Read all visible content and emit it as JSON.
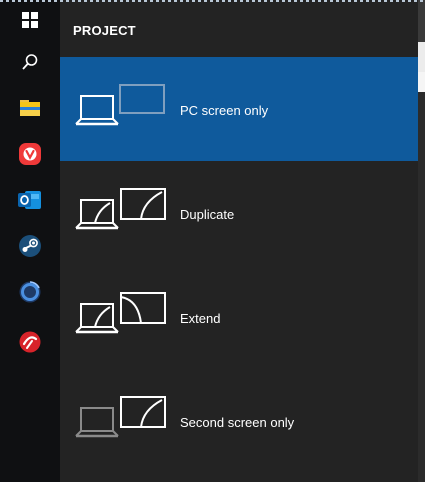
{
  "taskbar": {
    "items": [
      {
        "icon": "windows-start-icon"
      },
      {
        "icon": "search-icon"
      },
      {
        "icon": "file-explorer-icon"
      },
      {
        "icon": "vivaldi-icon"
      },
      {
        "icon": "outlook-icon"
      },
      {
        "icon": "steam-icon"
      },
      {
        "icon": "app-ring-icon"
      },
      {
        "icon": "red-app-icon"
      }
    ]
  },
  "panel": {
    "title": "PROJECT",
    "options": [
      {
        "label": "PC screen only",
        "selected": true
      },
      {
        "label": "Duplicate",
        "selected": false
      },
      {
        "label": "Extend",
        "selected": false
      },
      {
        "label": "Second screen only",
        "selected": false
      }
    ]
  },
  "colors": {
    "selected_bg": "#0f5a9c",
    "panel_bg": "#232323",
    "taskbar_bg": "#0f1012"
  }
}
